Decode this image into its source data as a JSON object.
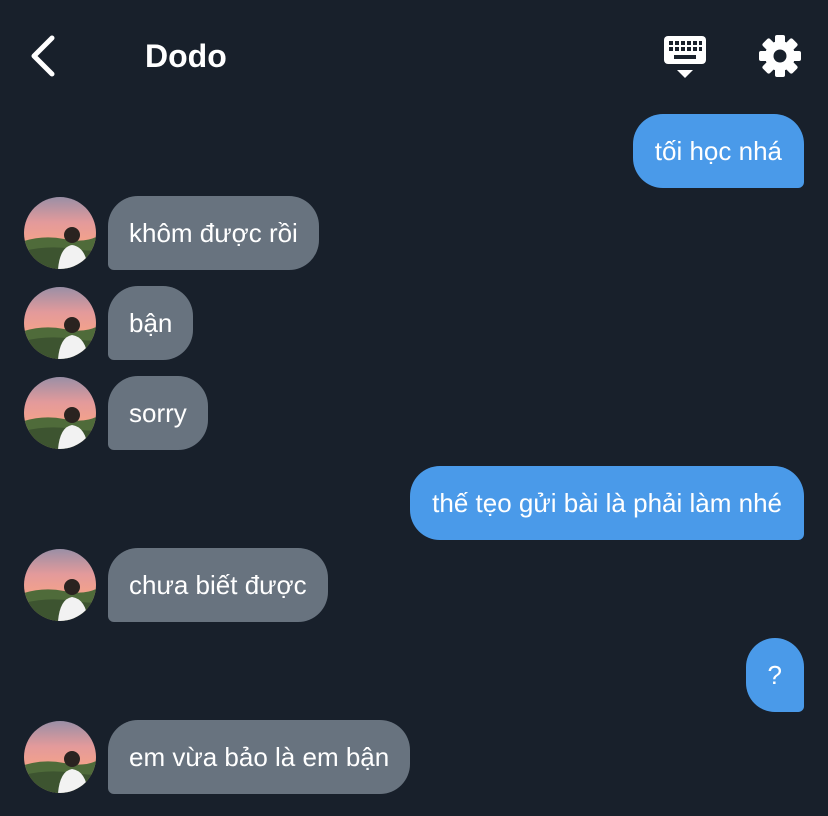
{
  "header": {
    "title": "Dodo",
    "back_icon": "chevron-left-icon",
    "keyboard_icon": "keyboard-icon",
    "settings_icon": "gear-icon"
  },
  "colors": {
    "background": "#18202b",
    "outgoing_bubble": "#4a9ae9",
    "incoming_bubble": "#68737f",
    "text": "#ffffff"
  },
  "messages": [
    {
      "direction": "outgoing",
      "text": "tối học nhá"
    },
    {
      "direction": "incoming",
      "text": "khôm được rồi"
    },
    {
      "direction": "incoming",
      "text": "bận"
    },
    {
      "direction": "incoming",
      "text": "sorry"
    },
    {
      "direction": "outgoing",
      "text": "thế tẹo gửi bài là phải làm nhé"
    },
    {
      "direction": "incoming",
      "text": "chưa biết được"
    },
    {
      "direction": "outgoing",
      "text": "?"
    },
    {
      "direction": "incoming",
      "text": "em vừa bảo là em bận"
    }
  ]
}
